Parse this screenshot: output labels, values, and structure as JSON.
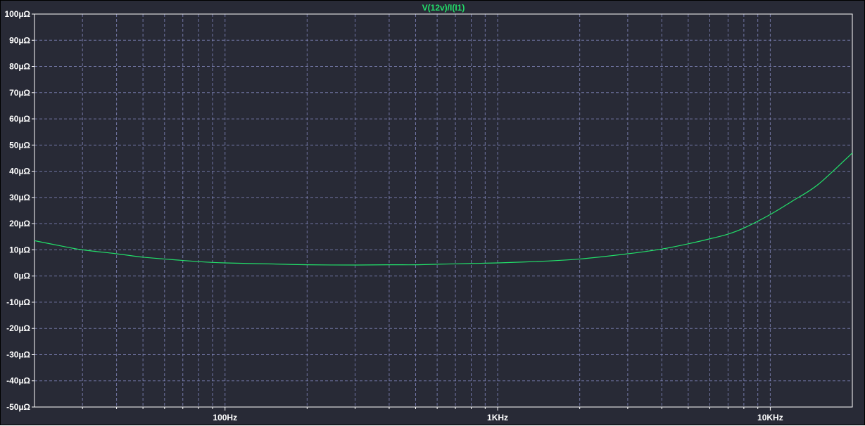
{
  "chart_data": {
    "type": "line",
    "title": "",
    "xlabel": "",
    "ylabel": "",
    "x_scale": "log",
    "xlim": [
      20,
      20000
    ],
    "ylim": [
      -50,
      100
    ],
    "y_unit": "µΩ",
    "grid": true,
    "x_tick_labels": [
      {
        "value": 100,
        "label": "100Hz"
      },
      {
        "value": 1000,
        "label": "1KHz"
      },
      {
        "value": 10000,
        "label": "10KHz"
      }
    ],
    "y_tick_labels": [
      {
        "value": 100,
        "label": "100µΩ"
      },
      {
        "value": 90,
        "label": "90µΩ"
      },
      {
        "value": 80,
        "label": "80µΩ"
      },
      {
        "value": 70,
        "label": "70µΩ"
      },
      {
        "value": 60,
        "label": "60µΩ"
      },
      {
        "value": 50,
        "label": "50µΩ"
      },
      {
        "value": 40,
        "label": "40µΩ"
      },
      {
        "value": 30,
        "label": "30µΩ"
      },
      {
        "value": 20,
        "label": "20µΩ"
      },
      {
        "value": 10,
        "label": "10µΩ"
      },
      {
        "value": 0,
        "label": "0µΩ"
      },
      {
        "value": -10,
        "label": "-10µΩ"
      },
      {
        "value": -20,
        "label": "-20µΩ"
      },
      {
        "value": -30,
        "label": "-30µΩ"
      },
      {
        "value": -40,
        "label": "-40µΩ"
      },
      {
        "value": -50,
        "label": "-50µΩ"
      }
    ],
    "series": [
      {
        "name": "V(12v)/I(I1)",
        "color": "#22e06a",
        "x": [
          20,
          25,
          30,
          40,
          50,
          60,
          80,
          100,
          150,
          200,
          300,
          400,
          500,
          600,
          800,
          1000,
          1500,
          2000,
          3000,
          4000,
          5000,
          6000,
          7000,
          8000,
          10000,
          12000,
          15000,
          20000
        ],
        "y": [
          13.5,
          11.5,
          10.0,
          8.5,
          7.2,
          6.5,
          5.5,
          5.0,
          4.6,
          4.3,
          4.2,
          4.3,
          4.3,
          4.5,
          4.8,
          5.0,
          5.7,
          6.5,
          8.5,
          10.3,
          12.3,
          14.2,
          16.0,
          18.3,
          23.5,
          28.5,
          35.0,
          47.0
        ]
      }
    ]
  },
  "colors": {
    "background": "#282a36",
    "grid": "#8a8fc8",
    "axis": "#ffffff",
    "text": "#ffffff"
  }
}
